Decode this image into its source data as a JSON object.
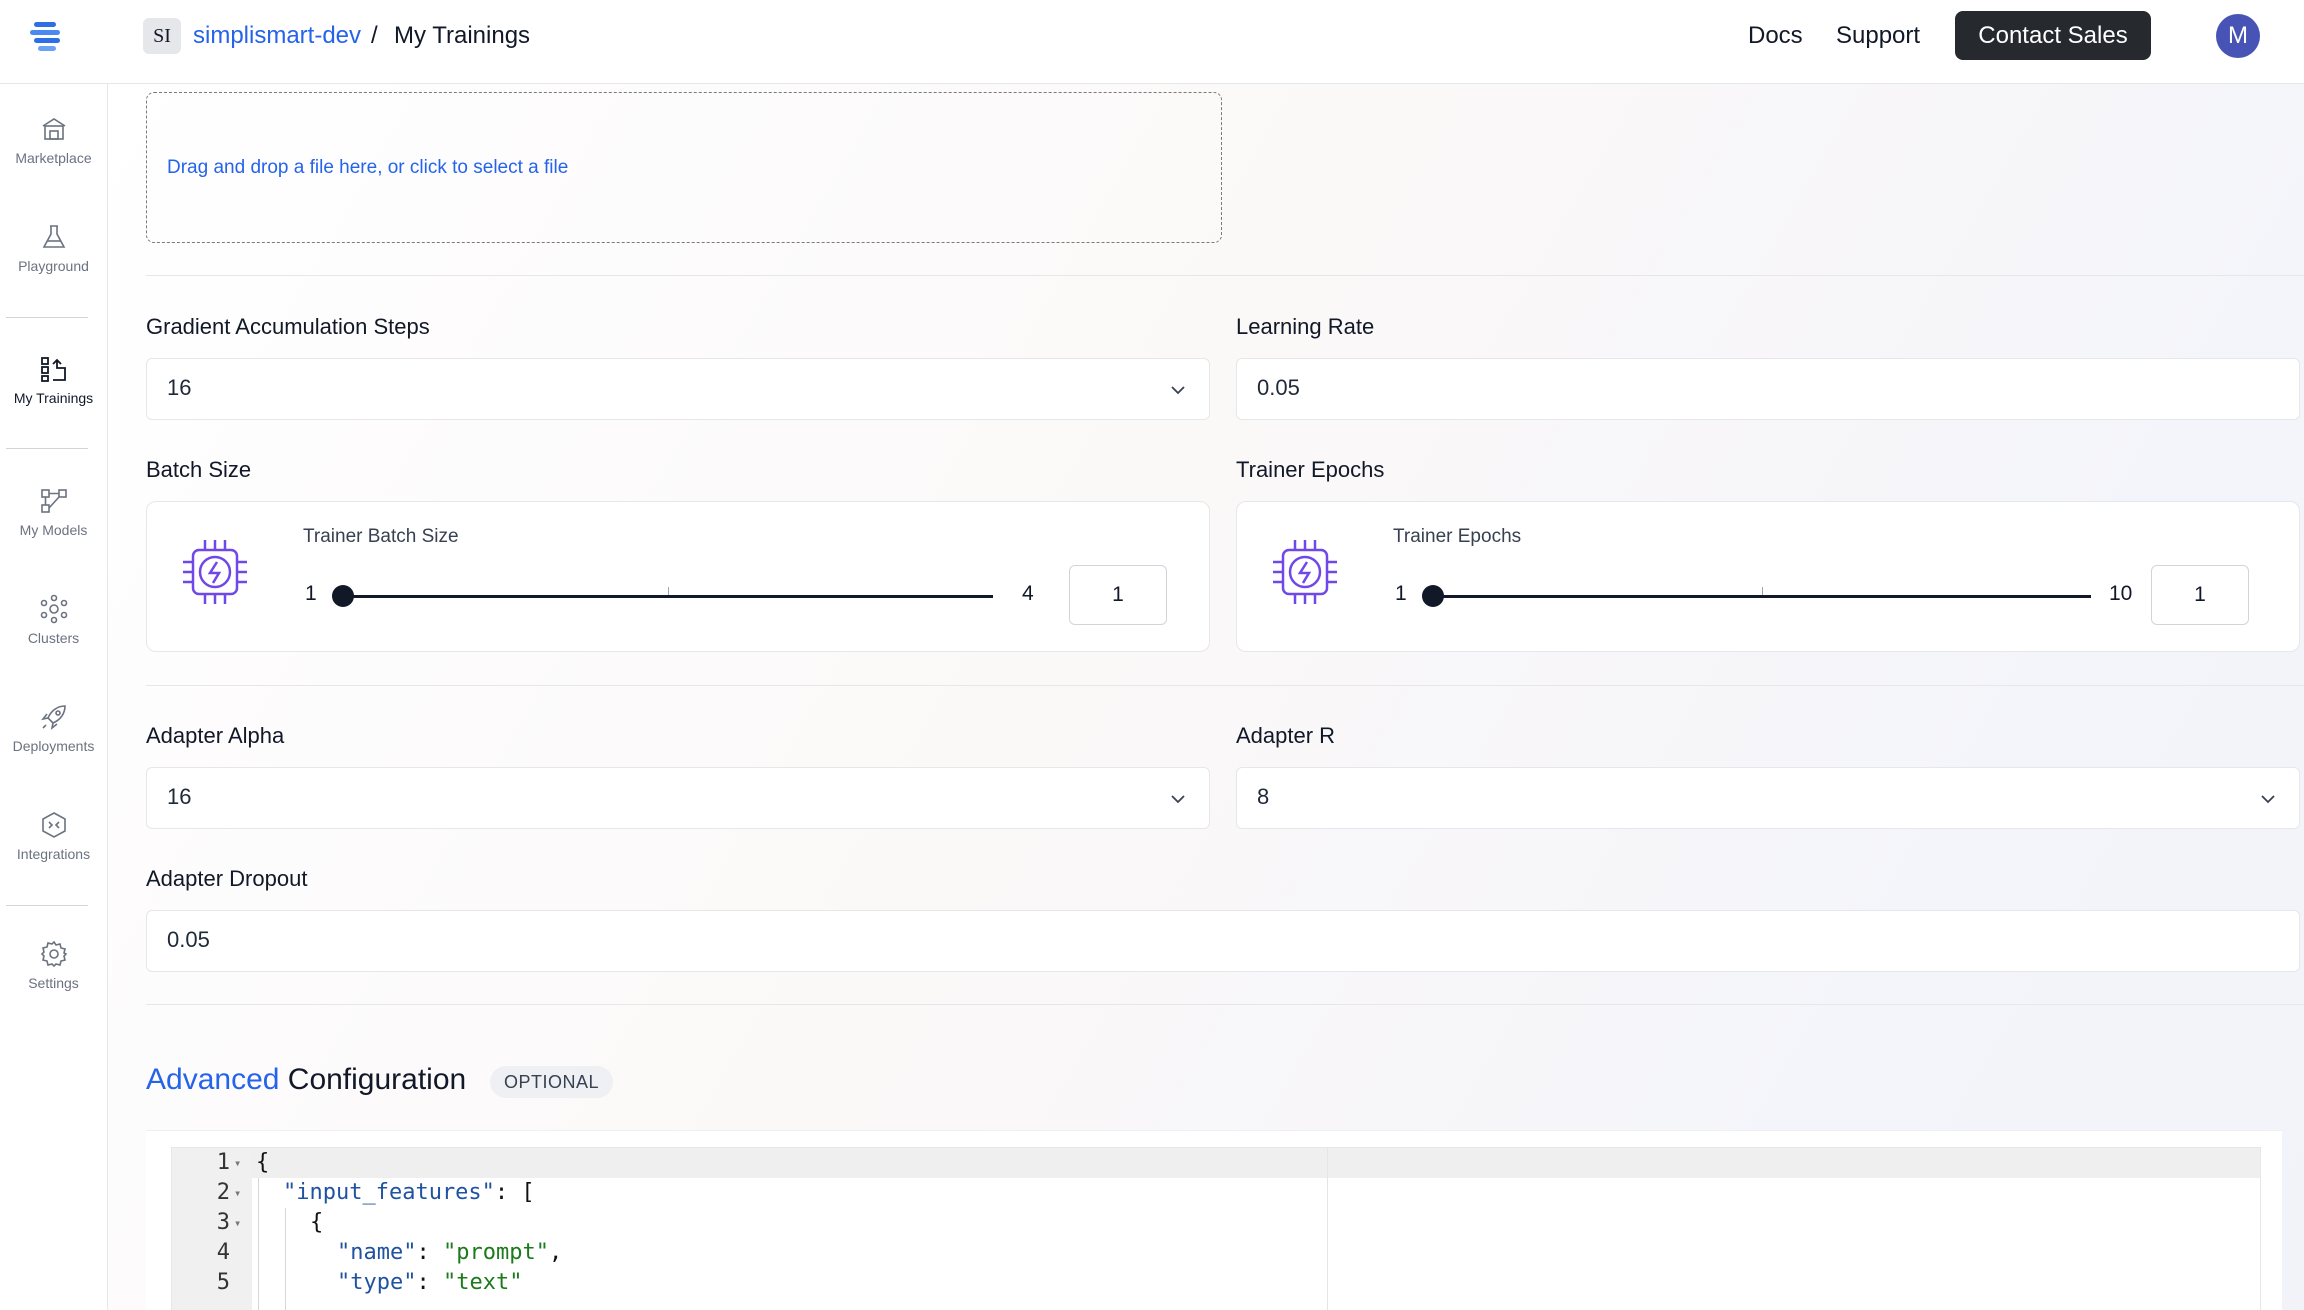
{
  "header": {
    "workspace_badge": "SI",
    "workspace_name": "simplismart-dev",
    "separator": "/",
    "page": "My Trainings",
    "docs": "Docs",
    "support": "Support",
    "contact_sales": "Contact Sales",
    "avatar_initial": "M"
  },
  "sidebar": {
    "items": [
      {
        "label": "Marketplace",
        "icon": "marketplace-icon"
      },
      {
        "label": "Playground",
        "icon": "flask-icon"
      },
      {
        "label": "My Trainings",
        "icon": "trainings-icon",
        "active": true
      },
      {
        "label": "My Models",
        "icon": "models-icon"
      },
      {
        "label": "Clusters",
        "icon": "clusters-icon"
      },
      {
        "label": "Deployments",
        "icon": "rocket-icon"
      },
      {
        "label": "Integrations",
        "icon": "integrations-icon"
      },
      {
        "label": "Settings",
        "icon": "gear-icon"
      }
    ]
  },
  "form": {
    "dropzone_text": "Drag and drop a file here, or click to select a file",
    "gradient_accumulation": {
      "label": "Gradient Accumulation Steps",
      "value": "16"
    },
    "learning_rate": {
      "label": "Learning Rate",
      "value": "0.05"
    },
    "batch_size": {
      "label": "Batch Size",
      "slider_title": "Trainer Batch Size",
      "min": "1",
      "max": "4",
      "value": "1"
    },
    "trainer_epochs": {
      "label": "Trainer Epochs",
      "slider_title": "Trainer Epochs",
      "min": "1",
      "max": "10",
      "value": "1"
    },
    "adapter_alpha": {
      "label": "Adapter Alpha",
      "value": "16"
    },
    "adapter_r": {
      "label": "Adapter R",
      "value": "8"
    },
    "adapter_dropout": {
      "label": "Adapter Dropout",
      "value": "0.05"
    }
  },
  "advanced": {
    "title_highlight": "Advanced",
    "title_rest": " Configuration",
    "badge": "OPTIONAL",
    "code_lines": [
      {
        "n": "1",
        "fold": true
      },
      {
        "n": "2",
        "fold": true
      },
      {
        "n": "3",
        "fold": true
      },
      {
        "n": "4",
        "fold": false
      },
      {
        "n": "5",
        "fold": false
      }
    ],
    "code": {
      "l1": "{",
      "l2_key": "\"input_features\"",
      "l2_rest": ": [",
      "l3": "{",
      "l4_key": "\"name\"",
      "l4_sep": ": ",
      "l4_val": "\"prompt\"",
      "l4_end": ",",
      "l5_key": "\"type\"",
      "l5_sep": ": ",
      "l5_val": "\"text\""
    }
  },
  "colors": {
    "accent": "#2563eb",
    "chip_icon": "#7048e8",
    "avatar": "#4754b6",
    "contact_button": "#262a2f"
  }
}
